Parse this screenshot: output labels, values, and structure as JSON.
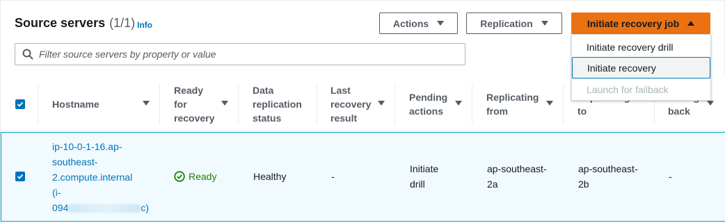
{
  "header": {
    "title": "Source servers",
    "count": "(1/1)",
    "info_link": "Info"
  },
  "toolbar": {
    "actions_label": "Actions",
    "replication_label": "Replication",
    "initiate_label": "Initiate recovery job"
  },
  "dropdown": {
    "items": [
      {
        "label": "Initiate recovery drill",
        "state": "normal"
      },
      {
        "label": "Initiate recovery",
        "state": "focused"
      },
      {
        "label": "Launch for failback",
        "state": "disabled"
      }
    ]
  },
  "search": {
    "placeholder": "Filter source servers by property or value",
    "value": ""
  },
  "table": {
    "columns": [
      {
        "lines": [
          "Hostname"
        ]
      },
      {
        "lines": [
          "Ready",
          "for",
          "recovery"
        ]
      },
      {
        "lines": [
          "Data",
          "replication",
          "status"
        ]
      },
      {
        "lines": [
          "Last",
          "recovery",
          "result"
        ]
      },
      {
        "lines": [
          "Pending",
          "actions"
        ]
      },
      {
        "lines": [
          "Replicating",
          "from"
        ]
      },
      {
        "lines": [
          "Replicating",
          "to"
        ]
      },
      {
        "lines": [
          "Failing",
          "back"
        ]
      }
    ],
    "rows": [
      {
        "selected": true,
        "hostname_lines": [
          "ip-10-0-1-16.ap-",
          "southeast-",
          "2.compute.internal",
          "(i-",
          "094",
          "c)"
        ],
        "ready": "Ready",
        "replication_status": "Healthy",
        "last_recovery_result": "-",
        "pending_actions": [
          "Initiate",
          "drill"
        ],
        "replicating_from": [
          "ap-southeast-",
          "2a"
        ],
        "replicating_to": [
          "ap-southeast-",
          "2b"
        ],
        "failing_back": "-"
      }
    ]
  },
  "colors": {
    "primary": "#ec7211",
    "link": "#0073bb",
    "ready_green": "#1d8102",
    "selected_row_bg": "#f1faff",
    "selected_row_border": "#00a1c9"
  }
}
